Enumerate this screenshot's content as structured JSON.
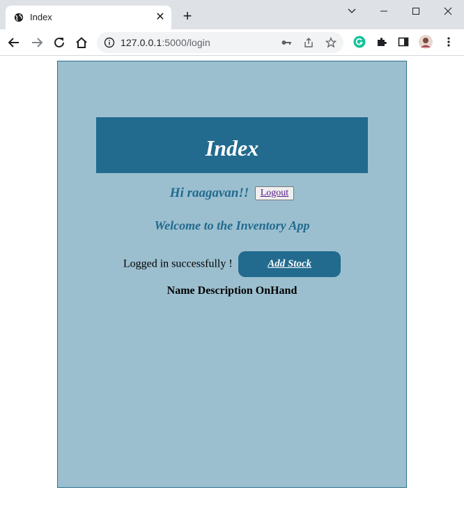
{
  "browser": {
    "tab_title": "Index",
    "url_host": "127.0.0.1",
    "url_path": ":5000/login"
  },
  "page": {
    "header_title": "Index",
    "greeting": "Hi raagavan!!",
    "logout_label": "Logout",
    "welcome": "Welcome to the Inventory App",
    "status_message": "Logged in successfully !",
    "add_stock_label": "Add Stock",
    "table_columns": [
      "Name",
      "Description",
      "OnHand"
    ]
  },
  "colors": {
    "panel_bg": "#9bbfcf",
    "accent": "#226a8e"
  }
}
